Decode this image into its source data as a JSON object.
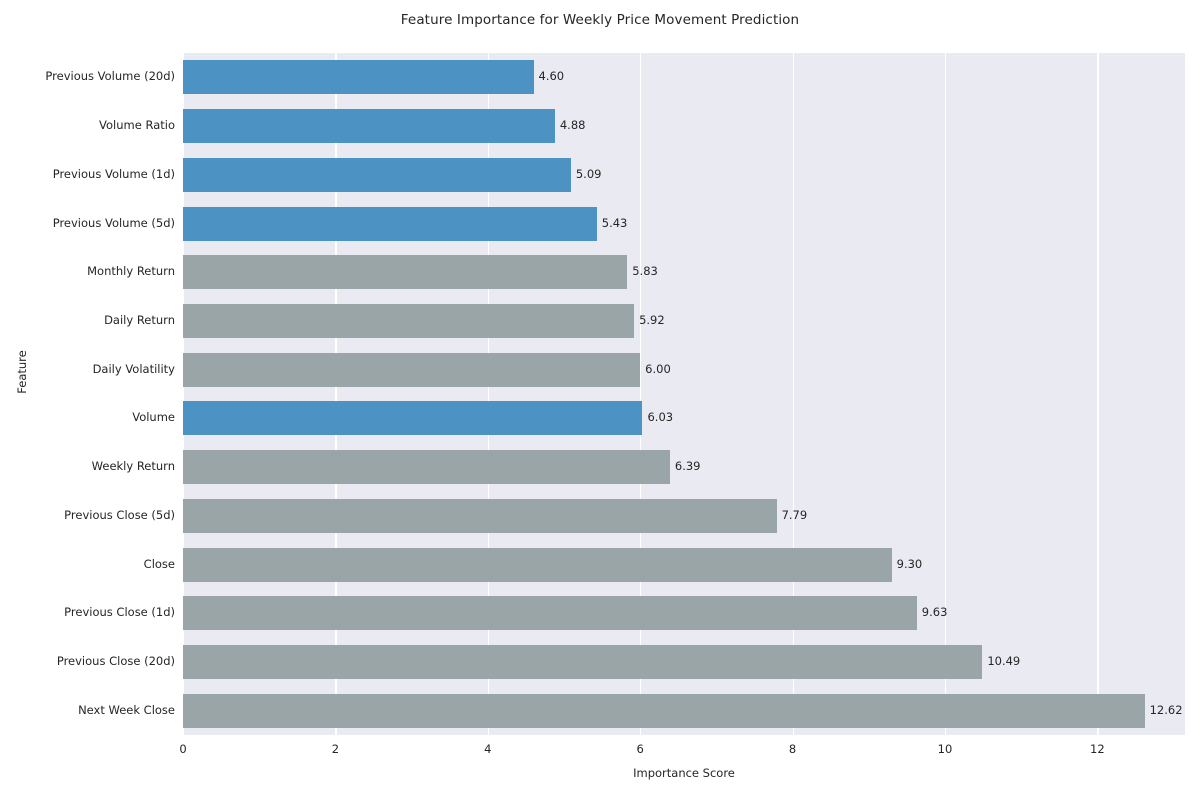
{
  "chart_data": {
    "type": "bar",
    "orientation": "horizontal",
    "title": "Feature Importance for Weekly Price Movement Prediction",
    "xlabel": "Importance Score",
    "ylabel": "Feature",
    "xlim": [
      0,
      13.15
    ],
    "xticks": [
      0,
      2,
      4,
      6,
      8,
      10,
      12
    ],
    "xtick_labels": [
      "0",
      "2",
      "4",
      "6",
      "8",
      "10",
      "12"
    ],
    "grid": "vertical",
    "legend": "none",
    "categories": [
      "Previous Volume (20d)",
      "Volume Ratio",
      "Previous Volume (1d)",
      "Previous Volume (5d)",
      "Monthly Return",
      "Daily Return",
      "Daily Volatility",
      "Volume",
      "Weekly Return",
      "Previous Close (5d)",
      "Close",
      "Previous Close (1d)",
      "Previous Close (20d)",
      "Next Week Close"
    ],
    "values": [
      4.6,
      4.88,
      5.09,
      5.43,
      5.83,
      5.92,
      6.0,
      6.03,
      6.39,
      7.79,
      9.3,
      9.63,
      10.49,
      12.62
    ],
    "value_labels": [
      "4.60",
      "4.88",
      "5.09",
      "5.43",
      "5.83",
      "5.92",
      "6.00",
      "6.03",
      "6.39",
      "7.79",
      "9.30",
      "9.63",
      "10.49",
      "12.62"
    ],
    "bar_colors": [
      "volume",
      "volume",
      "volume",
      "volume",
      "other",
      "other",
      "other",
      "volume",
      "other",
      "other",
      "other",
      "other",
      "other",
      "other"
    ],
    "colors": {
      "volume": "#4c93c3",
      "other": "#9aa5a7",
      "plot_background": "#eaeaf2",
      "figure_background": "#ffffff",
      "gridline": "#ffffff",
      "text": "#262626"
    }
  }
}
